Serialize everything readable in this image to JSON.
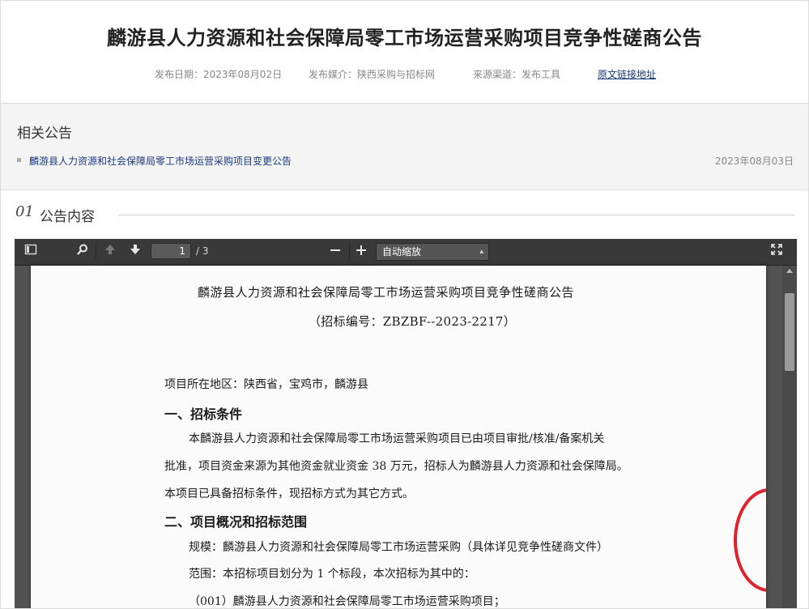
{
  "header": {
    "title": "麟游县人力资源和社会保障局零工市场运营采购项目竞争性磋商公告",
    "publish_date": "发布日期：2023年08月02日",
    "media": "发布媒介：陕西采购与招标网",
    "source": "来源渠道：发布工具",
    "original_link": "原文链接地址"
  },
  "related": {
    "title": "相关公告",
    "items": [
      {
        "label": "麟游县人力资源和社会保障局零工市场运营采购项目变更公告",
        "date": "2023年08月03日"
      }
    ]
  },
  "section": {
    "number": "01",
    "label": "公告内容"
  },
  "pdf_viewer": {
    "current_page": "1",
    "total_pages": "/ 3",
    "zoom_label": "自动缩放",
    "icons": {
      "sidebar": "sidebar-toggle-icon",
      "search": "search-icon",
      "prev": "arrow-up-icon",
      "next": "arrow-down-icon",
      "zoom_out": "minus-icon",
      "zoom_in": "plus-icon",
      "fullscreen": "fullscreen-icon"
    }
  },
  "document": {
    "title": "麟游县人力资源和社会保障局零工市场运营采购项目竞争性磋商公告",
    "code": "（招标编号：ZBZBF--2023-2217）",
    "location": "项目所在地区：陕西省，宝鸡市，麟游县",
    "heading1": "一、招标条件",
    "para1_line1": "本麟游县人力资源和社会保障局零工市场运营采购项目已由项目审批/核准/备案机关",
    "para1_line2": "批准，项目资金来源为其他资金就业资金 38 万元，招标人为麟游县人力资源和社会保障局。",
    "para1_line3": "本项目已具备招标条件，现招标方式为其它方式。",
    "heading2": "二、项目概况和招标范围",
    "scale": "规模：麟游县人力资源和社会保障局零工市场运营采购（具体详见竞争性磋商文件）",
    "scope": "范围：本招标项目划分为 1 个标段，本次招标为其中的：",
    "lot": "（001）麟游县人力资源和社会保障局零工市场运营采购项目；"
  },
  "colors": {
    "link": "#1a3a7a",
    "stamp_red": "#e0202a",
    "toolbar": "#393939"
  }
}
